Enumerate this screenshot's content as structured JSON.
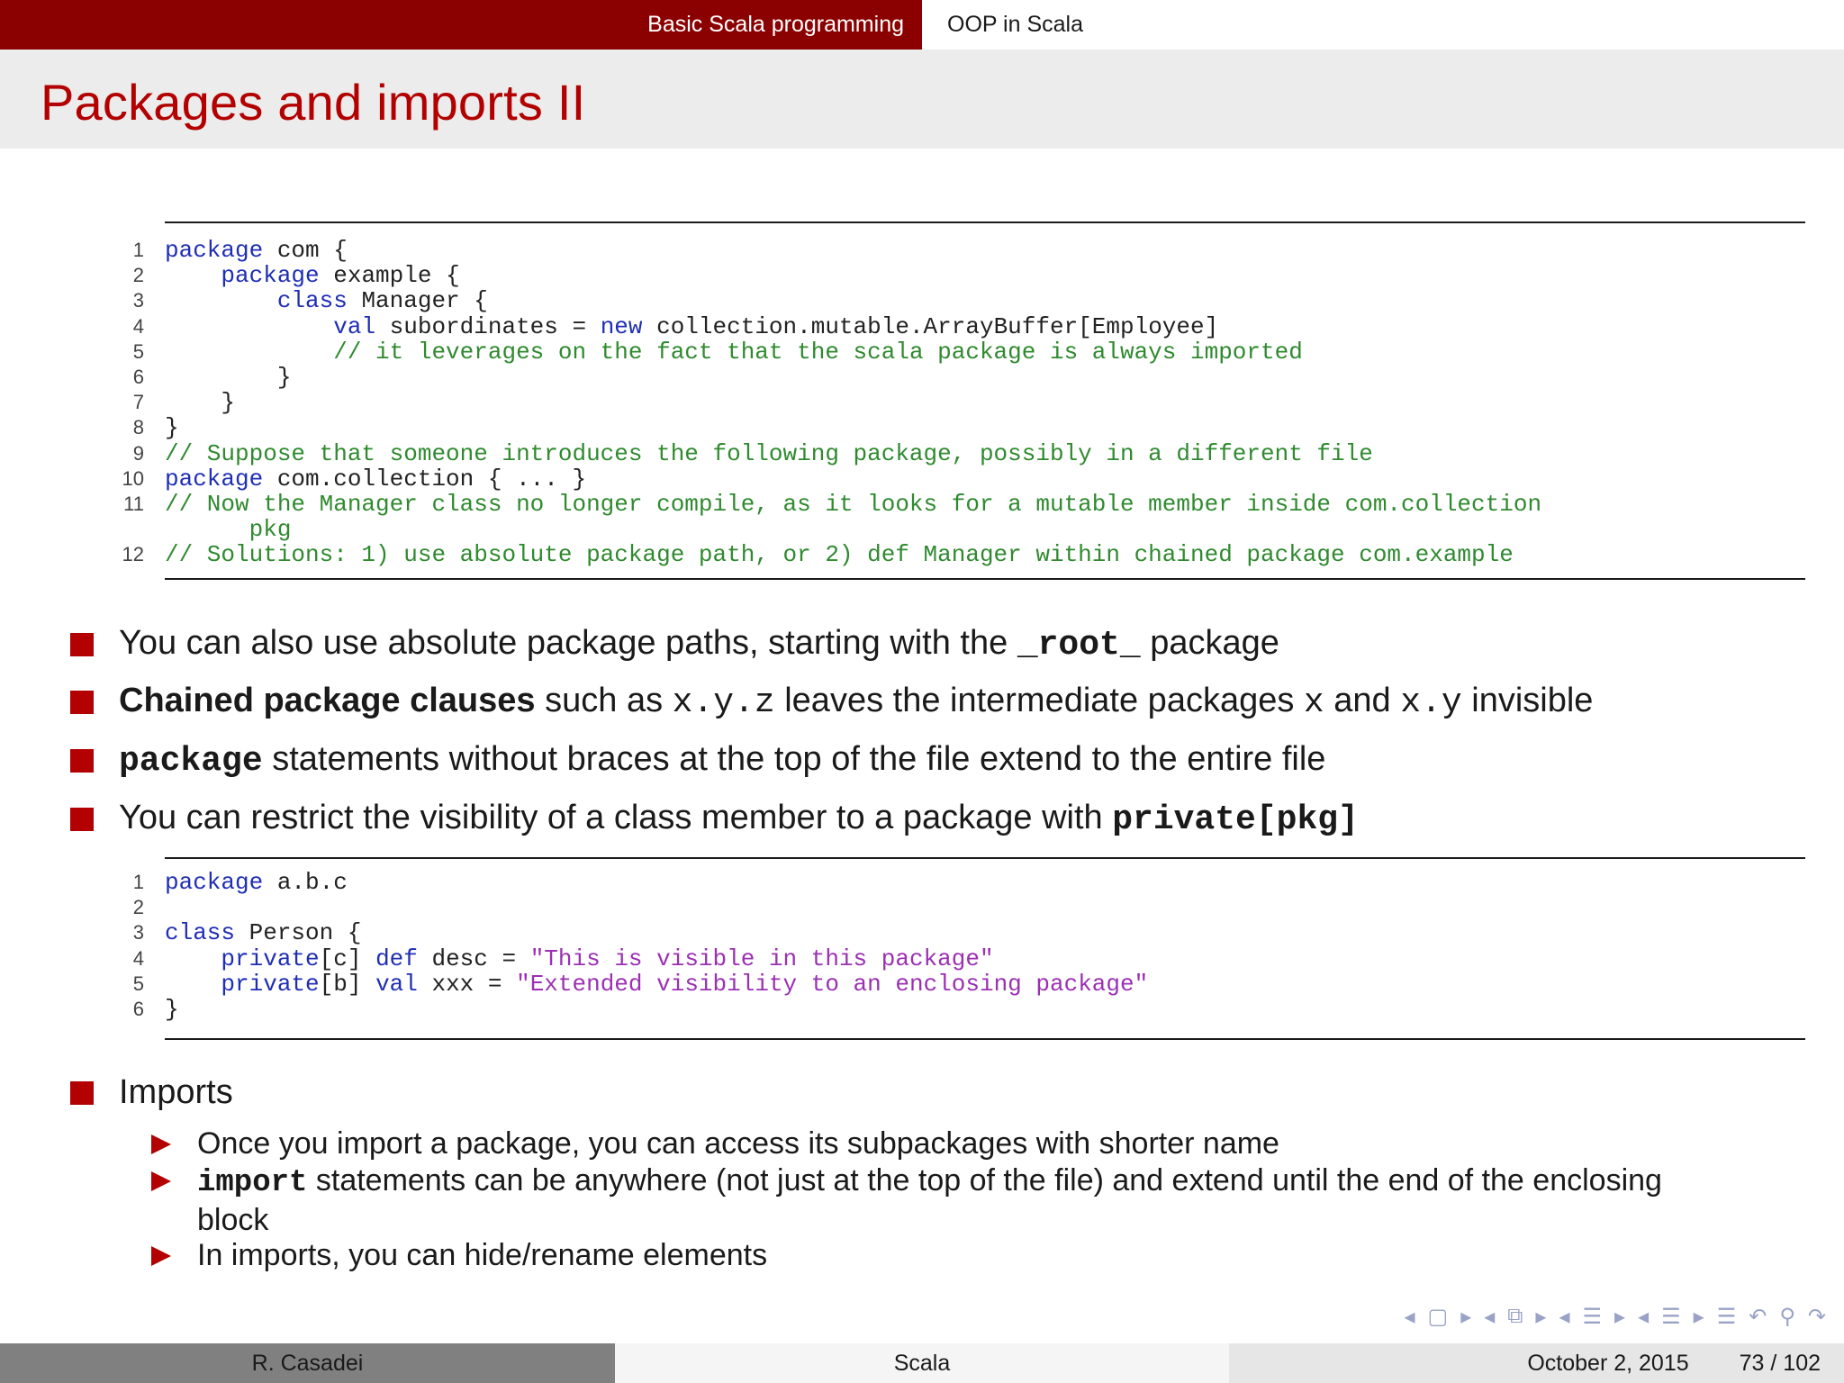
{
  "nav": {
    "section_active": "Basic Scala programming",
    "section_next": "OOP in Scala"
  },
  "title": "Packages and imports II",
  "listing1": [
    {
      "n": "1",
      "parts": [
        [
          "kw",
          "package"
        ],
        [
          "ct",
          " com {"
        ]
      ]
    },
    {
      "n": "2",
      "parts": [
        [
          "ct",
          "    "
        ],
        [
          "kw",
          "package"
        ],
        [
          "ct",
          " example {"
        ]
      ]
    },
    {
      "n": "3",
      "parts": [
        [
          "ct",
          "        "
        ],
        [
          "kw",
          "class"
        ],
        [
          "ct",
          " Manager {"
        ]
      ]
    },
    {
      "n": "4",
      "parts": [
        [
          "ct",
          "            "
        ],
        [
          "kw",
          "val"
        ],
        [
          "ct",
          " subordinates = "
        ],
        [
          "kw",
          "new"
        ],
        [
          "ct",
          " collection.mutable.ArrayBuffer[Employee]"
        ]
      ]
    },
    {
      "n": "5",
      "parts": [
        [
          "ct",
          "            "
        ],
        [
          "cm",
          "// it leverages on the fact that the scala package is always imported"
        ]
      ]
    },
    {
      "n": "6",
      "parts": [
        [
          "ct",
          "        }"
        ]
      ]
    },
    {
      "n": "7",
      "parts": [
        [
          "ct",
          "    }"
        ]
      ]
    },
    {
      "n": "8",
      "parts": [
        [
          "ct",
          "}"
        ]
      ]
    },
    {
      "n": "9",
      "parts": [
        [
          "cm",
          "// Suppose that someone introduces the following package, possibly in a different file"
        ]
      ]
    },
    {
      "n": "10",
      "parts": [
        [
          "kw",
          "package"
        ],
        [
          "ct",
          " com.collection { ... }"
        ]
      ]
    },
    {
      "n": "11",
      "parts": [
        [
          "cm",
          "// Now the Manager class no longer compile, as it looks for a mutable member inside com.collection"
        ]
      ]
    },
    {
      "n": "",
      "parts": [
        [
          "cm",
          "      pkg"
        ]
      ]
    },
    {
      "n": "12",
      "parts": [
        [
          "cm",
          "// Solutions: 1) use absolute package path, or 2) def Manager within chained package com.example"
        ]
      ]
    }
  ],
  "bullets": {
    "b1_pre": "You can also use absolute package paths, starting with the ",
    "b1_code": "_root_",
    "b1_post": " package",
    "b2_bold": "Chained package clauses",
    "b2_t1": " such as ",
    "b2_c1": "x.y.z",
    "b2_t2": " leaves the intermediate packages ",
    "b2_c2": "x",
    "b2_t3": " and ",
    "b2_c3": "x.y",
    "b2_t4": " invisible",
    "b3_code": "package",
    "b3_post": " statements without braces at the top of the file extend to the entire file",
    "b4_pre": "You can restrict the visibility of a class member to a package with ",
    "b4_code": "private[pkg]",
    "b5": "Imports"
  },
  "listing2": [
    {
      "n": "1",
      "parts": [
        [
          "kw",
          "package"
        ],
        [
          "ct",
          " a.b.c"
        ]
      ]
    },
    {
      "n": "2",
      "parts": [
        [
          "ct",
          ""
        ]
      ]
    },
    {
      "n": "3",
      "parts": [
        [
          "kw",
          "class"
        ],
        [
          "ct",
          " Person {"
        ]
      ]
    },
    {
      "n": "4",
      "parts": [
        [
          "ct",
          "    "
        ],
        [
          "kw",
          "private"
        ],
        [
          "ct",
          "[c] "
        ],
        [
          "kw",
          "def"
        ],
        [
          "ct",
          " desc = "
        ],
        [
          "st",
          "\"This is visible in this package\""
        ]
      ]
    },
    {
      "n": "5",
      "parts": [
        [
          "ct",
          "    "
        ],
        [
          "kw",
          "private"
        ],
        [
          "ct",
          "[b] "
        ],
        [
          "kw",
          "val"
        ],
        [
          "ct",
          " xxx = "
        ],
        [
          "st",
          "\"Extended visibility to an enclosing package\""
        ]
      ]
    },
    {
      "n": "6",
      "parts": [
        [
          "ct",
          "}"
        ]
      ]
    }
  ],
  "subbullets": {
    "s1": "Once you import a package, you can access its subpackages with shorter name",
    "s2_code": "import",
    "s2_post": " statements can be anywhere (not just at the top of the file) and extend until the end of the enclosing",
    "s2_cont": "block",
    "s3": "In imports, you can hide/rename elements"
  },
  "footer": {
    "author": "R. Casadei",
    "short_title": "Scala",
    "date": "October 2, 2015",
    "page": "73 / 102"
  },
  "colors": {
    "accent": "#8b0000",
    "title": "#b30000",
    "keyword": "#1f2eb4",
    "comment": "#2f8a2f",
    "string": "#9b30b3"
  }
}
